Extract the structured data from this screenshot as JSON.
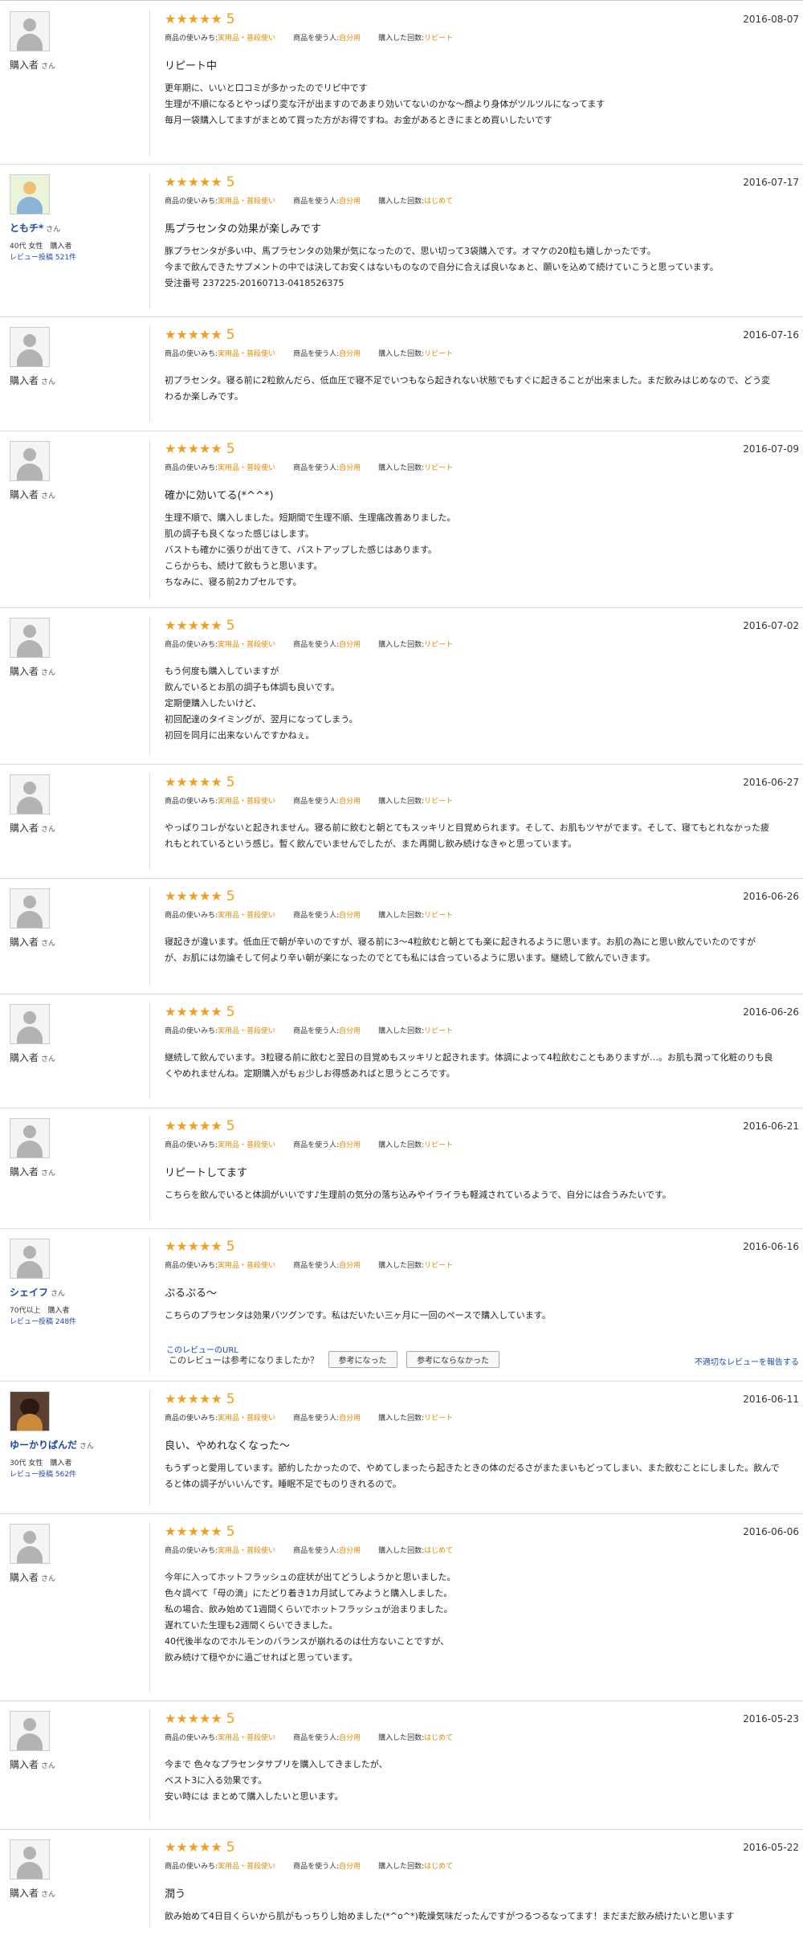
{
  "labels": {
    "san": "さん",
    "usage_label": "商品の使いみち:",
    "user_label": "商品を使う人:",
    "count_label": "購入した回数:",
    "stars": "★★★★★",
    "helpful_question": "このレビューは参考になりましたか？",
    "helpful_yes": "参考になった",
    "helpful_no": "参考にならなかった",
    "report": "不適切なレビューを報告する",
    "detail_link": "このレビューのURL"
  },
  "reviews": [
    {
      "name": "購入者",
      "meta1": "",
      "meta2": "",
      "score": "5",
      "date": "2016-08-07",
      "usage": "実用品・普段使い",
      "user": "自分用",
      "count": "リピート",
      "title": "リピート中",
      "body": "更年期に、いいと口コミが多かったのでリピ中です\n生理が不順になるとやっぱり変な汗が出ますのであまり効いてないのかな〜顔より身体がツルツルになってます\n毎月一袋購入してますがまとめて買った方がお得ですね。お金があるときにまとめ買いしたいです"
    },
    {
      "name": "ともチ*",
      "meta1": "40代 女性　購入者",
      "meta2": "レビュー投稿 521件",
      "score": "5",
      "date": "2016-07-17",
      "usage": "実用品・普段使い",
      "user": "自分用",
      "count": "はじめて",
      "title": "馬プラセンタの効果が楽しみです",
      "body": "豚プラセンタが多い中、馬プラセンタの効果が気になったので、思い切って3袋購入です。オマケの20粒も嬉しかったです。\n今まで飲んできたサプメントの中では決してお安くはないものなので自分に合えば良いなぁと、願いを込めて続けていこうと思っています。\n受注番号 237225-20160713-0418526375"
    },
    {
      "name": "購入者",
      "meta1": "",
      "meta2": "",
      "score": "5",
      "date": "2016-07-16",
      "usage": "実用品・普段使い",
      "user": "自分用",
      "count": "リピート",
      "title": "",
      "body": "初プラセンタ。寝る前に2粒飲んだら、低血圧で寝不足でいつもなら起きれない状態でもすぐに起きることが出来ました。まだ飲みはじめなので、どう変\nわるか楽しみです。"
    },
    {
      "name": "購入者",
      "meta1": "",
      "meta2": "",
      "score": "5",
      "date": "2016-07-09",
      "usage": "実用品・普段使い",
      "user": "自分用",
      "count": "リピート",
      "title": "確かに効いてる(*^^*)",
      "body": "生理不順で、購入しました。短期間で生理不順、生理痛改善ありました。\n肌の調子も良くなった感じはします。\nバストも確かに張りが出てきて、バストアップした感じはあります。\nこらからも、続けて飲もうと思います。\nちなみに、寝る前2カプセルです。"
    },
    {
      "name": "購入者",
      "meta1": "",
      "meta2": "",
      "score": "5",
      "date": "2016-07-02",
      "usage": "実用品・普段使い",
      "user": "自分用",
      "count": "リピート",
      "title": "",
      "body": "もう何度も購入していますが\n飲んでいるとお肌の調子も体調も良いです。\n定期便購入したいけど、\n初回配達のタイミングが、翌月になってしまう。\n初回を同月に出来ないんですかねぇ。"
    },
    {
      "name": "購入者",
      "meta1": "",
      "meta2": "",
      "score": "5",
      "date": "2016-06-27",
      "usage": "実用品・普段使い",
      "user": "自分用",
      "count": "リピート",
      "title": "",
      "body": "やっぱりコレがないと起きれません。寝る前に飲むと朝とてもスッキリと目覚められます。そして、お肌もツヤがでます。そして、寝てもとれなかった疲\nれもとれているという感じ。暫く飲んでいませんでしたが、また再開し飲み続けなきゃと思っています。"
    },
    {
      "name": "購入者",
      "meta1": "",
      "meta2": "",
      "score": "5",
      "date": "2016-06-26",
      "usage": "実用品・普段使い",
      "user": "自分用",
      "count": "リピート",
      "title": "",
      "body": "寝起きが違います。低血圧で朝が辛いのですが、寝る前に3〜4粒飲むと朝とても楽に起きれるように思います。お肌の為にと思い飲んでいたのですが\nが、お肌には勿論そして何より辛い朝が楽になったのでとても私には合っているように思います。継続して飲んでいきます。"
    },
    {
      "name": "購入者",
      "meta1": "",
      "meta2": "",
      "score": "5",
      "date": "2016-06-26",
      "usage": "実用品・普段使い",
      "user": "自分用",
      "count": "リピート",
      "title": "",
      "body": "継続して飲んでいます。3粒寝る前に飲むと翌日の目覚めもスッキリと起きれます。体調によって4粒飲むこともありますが…。お肌も潤って化粧のりも良\nくやめれませんね。定期購入がもぉ少しお得感あればと思うところです。"
    },
    {
      "name": "購入者",
      "meta1": "",
      "meta2": "",
      "score": "5",
      "date": "2016-06-21",
      "usage": "実用品・普段使い",
      "user": "自分用",
      "count": "リピート",
      "title": "リピートしてます",
      "body": "こちらを飲んでいると体調がいいです♪生理前の気分の落ち込みやイライラも軽減されているようで、自分には合うみたいです。"
    },
    {
      "name": "シェイフ",
      "meta1": "70代以上　購入者",
      "meta2": "レビュー投稿 248件",
      "score": "5",
      "date": "2016-06-16",
      "usage": "実用品・普段使い",
      "user": "自分用",
      "count": "リピート",
      "title": "ぷるぷる〜",
      "body": "こちらのプラセンタは効果バツグンです。私はだいたい三ヶ月に一回のペースで購入しています。"
    },
    {
      "name": "ゆーかりぱんだ",
      "meta1": "30代 女性　購入者",
      "meta2": "レビュー投稿 562件",
      "score": "5",
      "date": "2016-06-11",
      "usage": "実用品・普段使い",
      "user": "自分用",
      "count": "リピート",
      "title": "良い、やめれなくなった〜",
      "body": "もうずっと愛用しています。節約したかったので、やめてしまったら起きたときの体のだるさがまたまいもどってしまい、また飲むことにしました。飲んで\nると体の調子がいいんです。睡眠不足でものりきれるので。"
    },
    {
      "name": "購入者",
      "meta1": "",
      "meta2": "",
      "score": "5",
      "date": "2016-06-06",
      "usage": "実用品・普段使い",
      "user": "自分用",
      "count": "はじめて",
      "title": "",
      "body": "今年に入ってホットフラッシュの症状が出てどうしようかと思いました。\n色々調べて「母の滴」にたどり着き1カ月試してみようと購入しました。\n私の場合、飲み始めて1週間くらいでホットフラッシュが治まりました。\n遅れていた生理も2週間くらいできました。\n40代後半なのでホルモンのバランスが崩れるのは仕方ないことですが、\n飲み続けて穏やかに過ごせればと思っています。"
    },
    {
      "name": "購入者",
      "meta1": "",
      "meta2": "",
      "score": "5",
      "date": "2016-05-23",
      "usage": "実用品・普段使い",
      "user": "自分用",
      "count": "はじめて",
      "title": "",
      "body": "今まで 色々なプラセンタサプリを購入してきましたが、\nベスト3に入る効果です。\n安い時には まとめて購入したいと思います。"
    },
    {
      "name": "購入者",
      "meta1": "",
      "meta2": "",
      "score": "5",
      "date": "2016-05-22",
      "usage": "実用品・普段使い",
      "user": "自分用",
      "count": "はじめて",
      "title": "潤う",
      "body": "飲み始めて4日目くらいから肌がもっちりし始めました(*^o^*)乾燥気味だったんですがつるつるなってます！まだまだ飲み続けたいと思います"
    }
  ]
}
